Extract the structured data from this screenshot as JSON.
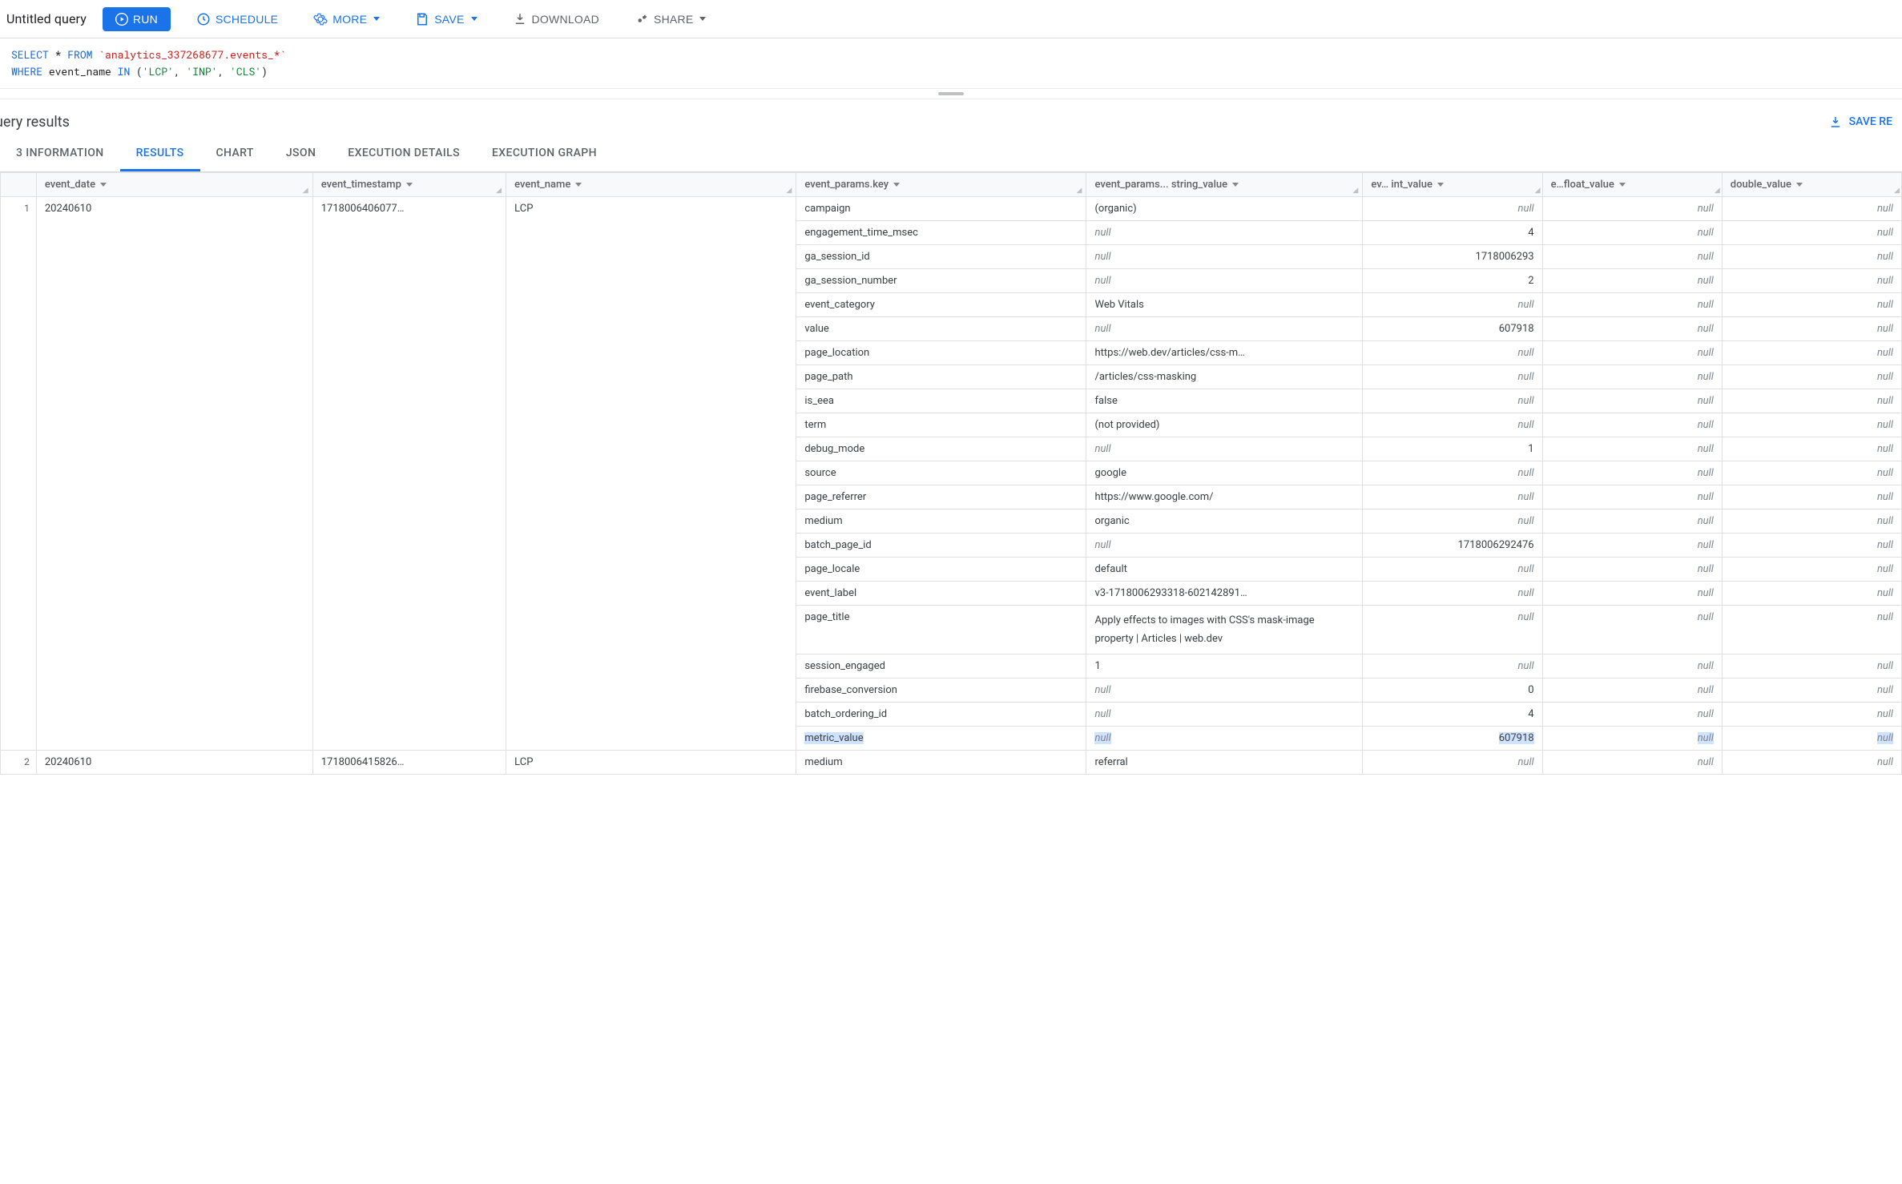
{
  "header": {
    "title": "Untitled query",
    "run": "RUN",
    "schedule": "SCHEDULE",
    "more": "MORE",
    "save": "SAVE",
    "download": "DOWNLOAD",
    "share": "SHARE"
  },
  "sql": {
    "line1_kw1": "SELECT",
    "line1_star": " * ",
    "line1_kw2": "FROM",
    "line1_tbl": " `analytics_337268677.events_*`",
    "line2_kw1": "WHERE",
    "line2_txt1": " event_name ",
    "line2_kw2": "IN",
    "line2_txt2": " (",
    "line2_s1": "'LCP'",
    "line2_c1": ", ",
    "line2_s2": "'INP'",
    "line2_c2": ", ",
    "line2_s3": "'CLS'",
    "line2_txt3": ")"
  },
  "results": {
    "title": "uery results",
    "save": "SAVE RE"
  },
  "tabs": {
    "info": "3 INFORMATION",
    "results": "RESULTS",
    "chart": "CHART",
    "json": "JSON",
    "exec_details": "EXECUTION DETAILS",
    "exec_graph": "EXECUTION GRAPH"
  },
  "cols": {
    "row": "",
    "date": "event_date",
    "ts": "event_timestamp",
    "name": "event_name",
    "key": "event_params.key",
    "str": "event_params... string_value",
    "int": "ev… int_value",
    "float": "e…float_value",
    "double": "double_value"
  },
  "groups": [
    {
      "row": "1",
      "date": "20240610",
      "ts": "1718006406077…",
      "name": "LCP",
      "params": [
        {
          "key": "campaign",
          "str": "(organic)",
          "int": null,
          "float": null,
          "double": null
        },
        {
          "key": "engagement_time_msec",
          "str": null,
          "int": "4",
          "float": null,
          "double": null
        },
        {
          "key": "ga_session_id",
          "str": null,
          "int": "1718006293",
          "float": null,
          "double": null
        },
        {
          "key": "ga_session_number",
          "str": null,
          "int": "2",
          "float": null,
          "double": null
        },
        {
          "key": "event_category",
          "str": "Web Vitals",
          "int": null,
          "float": null,
          "double": null
        },
        {
          "key": "value",
          "str": null,
          "int": "607918",
          "float": null,
          "double": null
        },
        {
          "key": "page_location",
          "str": "https://web.dev/articles/css-m…",
          "int": null,
          "float": null,
          "double": null
        },
        {
          "key": "page_path",
          "str": "/articles/css-masking",
          "int": null,
          "float": null,
          "double": null
        },
        {
          "key": "is_eea",
          "str": "false",
          "int": null,
          "float": null,
          "double": null
        },
        {
          "key": "term",
          "str": "(not provided)",
          "int": null,
          "float": null,
          "double": null
        },
        {
          "key": "debug_mode",
          "str": null,
          "int": "1",
          "float": null,
          "double": null
        },
        {
          "key": "source",
          "str": "google",
          "int": null,
          "float": null,
          "double": null
        },
        {
          "key": "page_referrer",
          "str": "https://www.google.com/",
          "int": null,
          "float": null,
          "double": null
        },
        {
          "key": "medium",
          "str": "organic",
          "int": null,
          "float": null,
          "double": null
        },
        {
          "key": "batch_page_id",
          "str": null,
          "int": "1718006292476",
          "float": null,
          "double": null
        },
        {
          "key": "page_locale",
          "str": "default",
          "int": null,
          "float": null,
          "double": null
        },
        {
          "key": "event_label",
          "str": "v3-1718006293318-602142891…",
          "int": null,
          "float": null,
          "double": null
        },
        {
          "key": "page_title",
          "str": "Apply effects to images with CSS's mask-image property  |  Articles  |  web.dev",
          "int": null,
          "float": null,
          "double": null,
          "wrap": true
        },
        {
          "key": "session_engaged",
          "str": "1",
          "int": null,
          "float": null,
          "double": null
        },
        {
          "key": "firebase_conversion",
          "str": null,
          "int": "0",
          "float": null,
          "double": null
        },
        {
          "key": "batch_ordering_id",
          "str": null,
          "int": "4",
          "float": null,
          "double": null
        },
        {
          "key": "metric_value",
          "str": null,
          "int": "607918",
          "float": null,
          "double": null,
          "hl": true
        }
      ]
    },
    {
      "row": "2",
      "date": "20240610",
      "ts": "1718006415826…",
      "name": "LCP",
      "params": [
        {
          "key": "medium",
          "str": "referral",
          "int": null,
          "float": null,
          "double": null
        }
      ]
    }
  ]
}
